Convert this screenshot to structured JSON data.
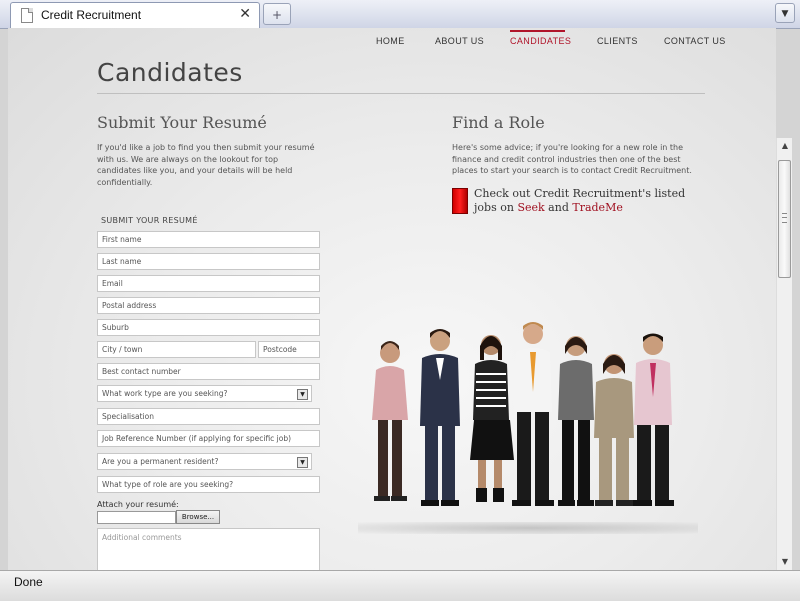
{
  "browser": {
    "tab_title": "Credit Recruitment",
    "tab_close": "✕",
    "new_tab": "+",
    "tab_list": "▼",
    "status": "Done"
  },
  "nav": {
    "items": [
      "HOME",
      "ABOUT US",
      "CANDIDATES",
      "CLIENTS",
      "CONTACT US"
    ],
    "active": "CANDIDATES"
  },
  "page": {
    "title": "Candidates"
  },
  "submit": {
    "heading": "Submit Your Resumé",
    "intro": "If you'd like a job to find you then submit your resumé with us. We are always on the lookout for top candidates like you, and your details will be held confidentially.",
    "form_label": "SUBMIT YOUR RESUMÉ",
    "fields": {
      "first_name": "First name",
      "last_name": "Last name",
      "email": "Email",
      "postal_address": "Postal address",
      "suburb": "Suburb",
      "city": "City / town",
      "postcode": "Postcode",
      "contact_number": "Best contact number",
      "work_type": "What work type are you seeking?",
      "specialisation": "Specialisation",
      "job_reference": "Job Reference Number (if applying for specific job)",
      "permanent_resident": "Are you a permanent resident?",
      "role_type": "What type of role are you seeking?",
      "comments": "Additional comments"
    },
    "attach_label": "Attach your resumé:",
    "browse_label": "Browse..."
  },
  "role": {
    "heading": "Find a Role",
    "intro": "Here's some advice; if you're looking for a new role in the finance and credit control industries then one of the best places to start your search is to contact Credit Recruitment.",
    "link_text": "Check out Credit Recruitment's listed jobs on",
    "link_seek": "Seek",
    "link_and": "and",
    "link_trademe": "TradeMe"
  },
  "colors": {
    "accent": "#b0142a",
    "red_box": "#e00000"
  }
}
